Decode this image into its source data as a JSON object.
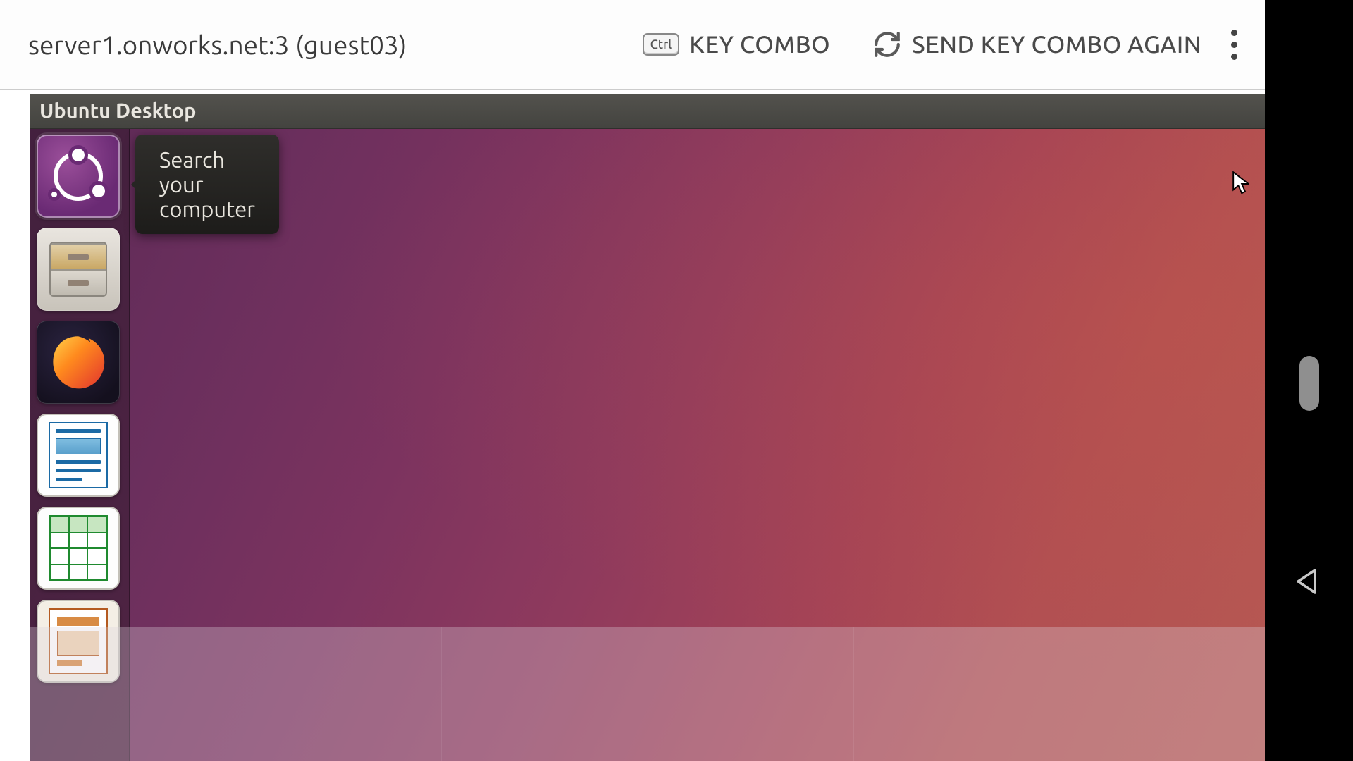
{
  "toolbar": {
    "address": "server1.onworks.net:3 (guest03)",
    "ctrl_badge": "Ctrl",
    "key_combo_label": "KEY COMBO",
    "send_again_label": "SEND KEY COMBO AGAIN"
  },
  "ubuntu": {
    "menu_title": "Ubuntu Desktop",
    "tooltip": "Search your computer",
    "launcher": [
      {
        "name": "dash",
        "label": "Search your computer"
      },
      {
        "name": "files",
        "label": "Files"
      },
      {
        "name": "firefox",
        "label": "Firefox Web Browser"
      },
      {
        "name": "writer",
        "label": "LibreOffice Writer"
      },
      {
        "name": "calc",
        "label": "LibreOffice Calc"
      },
      {
        "name": "impress",
        "label": "LibreOffice Impress"
      }
    ]
  }
}
